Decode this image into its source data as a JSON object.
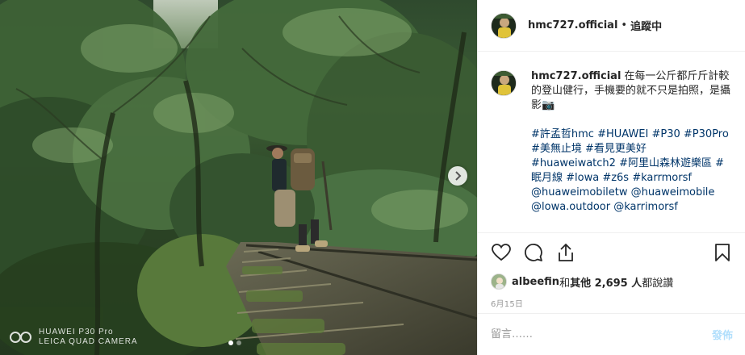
{
  "post": {
    "username": "hmc727.official",
    "separator": "•",
    "follow_status": "追蹤中",
    "caption_text": "在每一公斤都斤斤計較的登山健行，手機要的就不只是拍照，是攝影📷",
    "hashtag_lines": [
      "#許孟哲hmc #HUAWEI #P30 #P30Pro",
      "#美無止境 #看見更美好",
      "#huaweiwatch2 #阿里山森林遊樂區 #",
      "眠月線 #lowa #z6s #karrmorsf",
      "@huaweimobiletw @huaweimobile",
      "@lowa.outdoor @karrimorsf"
    ]
  },
  "photo": {
    "watermark_line1": "HUAWEI P30 Pro",
    "watermark_line2": "LEICA QUAD CAMERA",
    "carousel_total": 2,
    "carousel_active": 1
  },
  "likes": {
    "liker": "albeefin",
    "and_text": " 和 ",
    "others": "其他 2,695 人",
    "suffix": " 都說讚"
  },
  "date": "6月15日",
  "comment": {
    "placeholder": "留言……",
    "post_label": "發佈"
  },
  "icons": {
    "like": "heart-icon",
    "comment": "comment-icon",
    "share": "share-icon",
    "save": "bookmark-icon",
    "next": "chevron-right-icon"
  },
  "colors": {
    "link": "#003569",
    "muted": "#999999",
    "post_button_disabled": "#b2dffc",
    "border": "#efefef"
  }
}
